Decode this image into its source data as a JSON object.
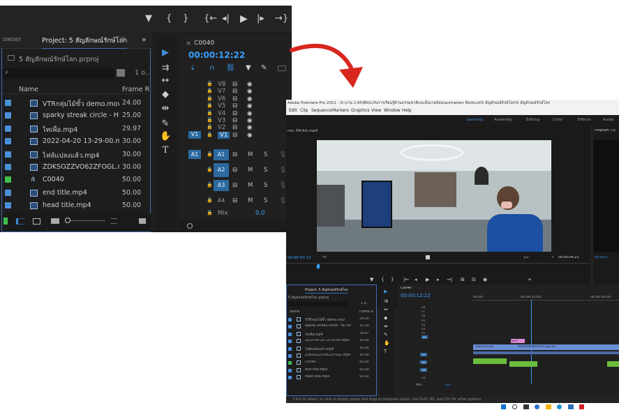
{
  "zoom": {
    "transport_icons": [
      "marker-icon",
      "in-point-icon",
      "out-point-icon",
      "go-to-in-icon",
      "step-back-icon",
      "play-icon",
      "step-forward-icon",
      "go-to-out-icon"
    ],
    "browser_tab_fragment": "owser",
    "project_tab": "Project: 5 สัญลักษณ์รักษ์โลก",
    "panel_menu_glyph": "≡",
    "expand_glyph": "»",
    "project_file": "5 สัญลักษณ์รักษ์โลก.prproj",
    "item_count": "1 o...",
    "columns": {
      "name": "Name",
      "frame_rate": "Frame R"
    },
    "items": [
      {
        "name": "VTRกลุ่มไม้ขั้ว demo.mov",
        "fr": "24.00",
        "color": "#4a90d9",
        "kind": "clip"
      },
      {
        "name": "sparky streak circle - HD ov",
        "fr": "25.00",
        "color": "#4a90d9",
        "kind": "clip"
      },
      {
        "name": "ไทเพื่อ.mp4",
        "fr": "29.97",
        "color": "#4a90d9",
        "kind": "clip"
      },
      {
        "name": "2022-04-20 13-29-00.mp4",
        "fr": "30.00",
        "color": "#4a90d9",
        "kind": "clip"
      },
      {
        "name": "ไฟล์แปลงแล้ว.mp4",
        "fr": "30.00",
        "color": "#4a90d9",
        "kind": "clip"
      },
      {
        "name": "ZDKSOZZVO62ZFOGL.mp4",
        "fr": "30.00",
        "color": "#4a90d9",
        "kind": "clip"
      },
      {
        "name": "C0040",
        "fr": "50.00",
        "color": "#3fbf4f",
        "kind": "sequence"
      },
      {
        "name": "end title.mp4",
        "fr": "50.00",
        "color": "#4a90d9",
        "kind": "clip"
      },
      {
        "name": "head title.mp4",
        "fr": "50.00",
        "color": "#4a90d9",
        "kind": "clip"
      }
    ],
    "sequence_tab": "C0040",
    "timecode": "00:00:12:22",
    "video_tracks": [
      "V8",
      "V7",
      "V6",
      "V5",
      "V4",
      "V3",
      "V2",
      "V1"
    ],
    "audio_tracks": [
      "A1",
      "A2",
      "A3",
      "A4"
    ],
    "source_patch_v": "V1",
    "source_patch_a": "A1",
    "mute_label": "M",
    "solo_label": "S",
    "mix_label": "Mix",
    "mix_value": "0.0"
  },
  "full": {
    "title_bar": "Adobe Premiere Pro 2021 - D:\\งาน 2-65\\ศิลปะกับการเรียนรู้ด้านธรรมชาติและสิ่งแวดล้อม\\animation ท้องทะเล\\5 สัญลักษณ์รักษ์โลก\\5 สัญลักษณ์รักษ์โลก",
    "menu": [
      "Edit",
      "Clip",
      "Sequence",
      "Markers",
      "Graphics",
      "View",
      "Window",
      "Help"
    ],
    "workspaces": [
      "Learning",
      "Assembly",
      "Editing",
      "Color",
      "Effects",
      "Audio"
    ],
    "source_tab": "rce: PR-Art.mp4",
    "program_tab": "Program: C0",
    "source_in_time": "00:00:47:13",
    "fit_label": "Fit",
    "scale_label": "1/2",
    "source_duration": "00:00:04:23",
    "program_time_fragment": "00:00:1",
    "project_tab": "Project: 5 สัญลักษณ์รักษ์โลก",
    "project_file": "5 สัญลักษณ์รักษ์โลก.prproj",
    "item_count": "1 o...",
    "columns": {
      "name": "Name",
      "frame_rate": "Frame R"
    },
    "items": [
      {
        "name": "VTRกลุ่มไม้ขั้ว demo.mov",
        "fr": "24.00"
      },
      {
        "name": "sparky streak circle - HD ov",
        "fr": "25.00"
      },
      {
        "name": "ไทเพื่อ.mp4",
        "fr": "29.97"
      },
      {
        "name": "2022-04-20 13-29-00.mp4",
        "fr": "30.00"
      },
      {
        "name": "ไฟล์แปลงแล้ว.mp4",
        "fr": "30.00"
      },
      {
        "name": "ZDKSOZZVO62ZFOGL.mp4",
        "fr": "30.00"
      },
      {
        "name": "C0040",
        "fr": "50.00"
      },
      {
        "name": "end title.mp4",
        "fr": "50.00"
      },
      {
        "name": "head title.mp4",
        "fr": "50.00"
      }
    ],
    "sequence_tab": "C0040",
    "timecode": "00:00:12:22",
    "ruler": [
      "00:00",
      "00:00:15:00",
      "00:00:30:00"
    ],
    "clip_pink": "ไฟล์ R",
    "clip_v1a": "head title.mp4",
    "clip_v1b": "ZDKSOZZVO62ZFOGL.mp4 [V]",
    "mix_label": "Mix",
    "mix_value": "0.0",
    "status": "Click to select, or click in empty space and drag to marquee select. Use Shift, Alt, and Ctrl for other options.",
    "taskbar_icons": [
      "windows-icon",
      "search-icon",
      "task-view-icon",
      "chrome-icon",
      "explorer-icon",
      "edge-icon",
      "store-icon",
      "acrobat-icon"
    ]
  },
  "colors": {
    "accent_blue": "#3d6fb5",
    "timecode_blue": "#3aa0ff",
    "track_blue": "#2c6aa0",
    "arrow_red": "#d9271f",
    "clip_green": "#6bbd3c",
    "clip_pink": "#e08ad8",
    "clip_blue": "#6a8fd6"
  }
}
